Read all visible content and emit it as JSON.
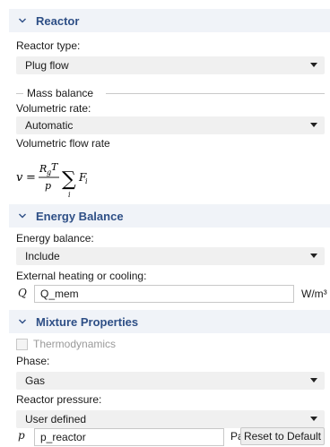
{
  "reactor": {
    "title": "Reactor",
    "reactor_type_label": "Reactor type:",
    "reactor_type_value": "Plug flow",
    "mass_balance_label": "Mass balance",
    "volumetric_rate_label": "Volumetric rate:",
    "volumetric_rate_value": "Automatic",
    "volumetric_flow_label": "Volumetric flow rate",
    "formula": {
      "lhs": "v",
      "num_r": "R",
      "num_sub": "g",
      "num_t": "T",
      "den": "p",
      "sum_sub": "i",
      "term": "F",
      "term_sub": "i"
    }
  },
  "energy": {
    "title": "Energy Balance",
    "energy_balance_label": "Energy balance:",
    "energy_balance_value": "Include",
    "heating_label": "External heating or cooling:",
    "q_symbol": "Q",
    "q_value": "Q_mem",
    "q_unit": "W/m³"
  },
  "mixture": {
    "title": "Mixture Properties",
    "thermo_label": "Thermodynamics",
    "phase_label": "Phase:",
    "phase_value": "Gas",
    "pressure_label": "Reactor pressure:",
    "pressure_value": "User defined",
    "p_symbol": "p",
    "p_value": "p_reactor",
    "p_unit": "Pa",
    "reset_label": "Reset to Default"
  },
  "colors": {
    "header_bg": "#f0f3f8",
    "header_text": "#2e4f86",
    "select_bg": "#f0f0f0"
  },
  "icons": {
    "collapse": "chevron-down-icon",
    "dropdown": "caret-down-icon"
  }
}
